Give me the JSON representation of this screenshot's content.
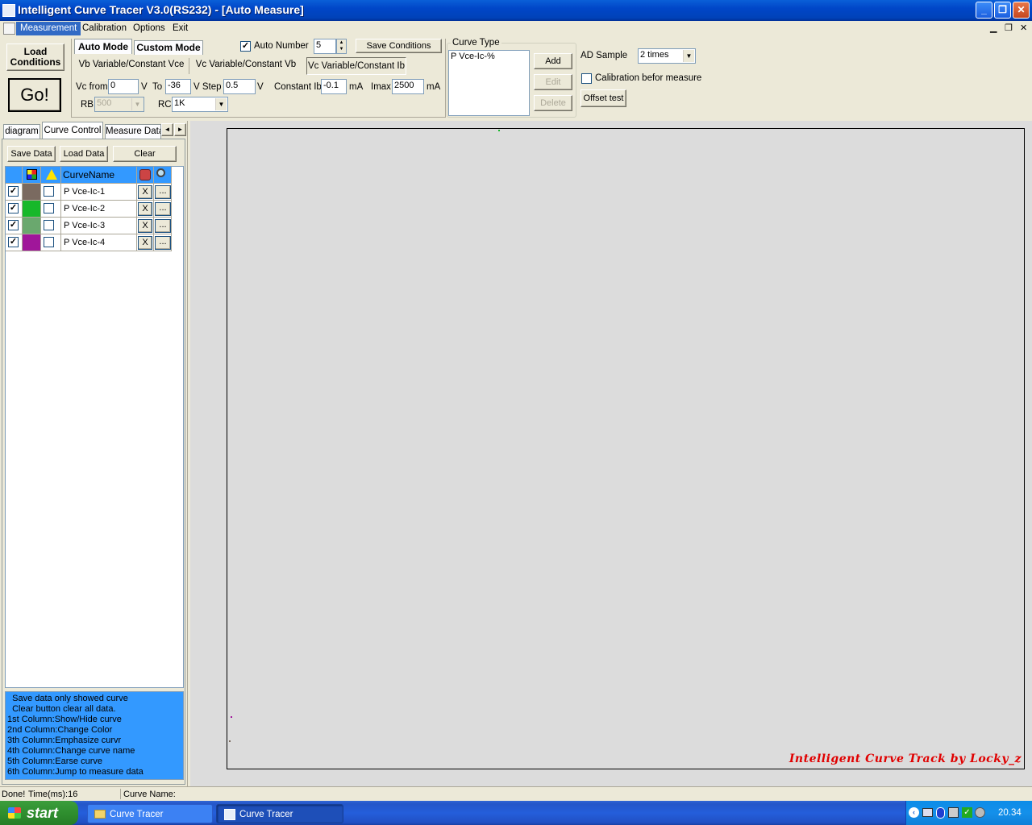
{
  "window": {
    "title": "Intelligent Curve Tracer V3.0(RS232) - [Auto Measure]",
    "controls": {
      "minimize": "_",
      "maximize": "❐",
      "close": "✕"
    }
  },
  "menu": [
    "Measurement",
    "Calibration",
    "Options",
    "Exit"
  ],
  "toolbar": {
    "load_conditions": "Load Conditions",
    "go": "Go!",
    "mode_tabs": [
      "Auto Mode",
      "Custom Mode"
    ],
    "auto_number_label": "Auto Number",
    "auto_number_checked": "✓",
    "auto_number_value": "5",
    "save_conditions": "Save Conditions",
    "sub_tabs": [
      "Vb Variable/Constant Vce",
      "Vc Variable/Constant Vb",
      "Vc Variable/Constant Ib"
    ],
    "vc_from_label": "Vc from",
    "vc_from_value": "0",
    "v_unit": "V",
    "to_label": "To",
    "to_value": "-36",
    "step_label": "V Step",
    "step_value": "0.5",
    "step_unit": "V",
    "constant_ib_label": "Constant Ib",
    "constant_ib_value": "-0.1",
    "ma_unit": "mA",
    "imax_label": "Imax",
    "imax_value": "2500",
    "imax_unit": "mA",
    "rb_label": "RB",
    "rb_value": "500",
    "rc_label": "RC",
    "rc_value": "1K"
  },
  "curve_type": {
    "title": "Curve Type",
    "items": [
      "P Vce-Ic-%"
    ],
    "add": "Add",
    "edit": "Edit",
    "delete": "Delete"
  },
  "ad": {
    "sample_label": "AD Sample",
    "sample_value": "2 times",
    "calibration_label": "Calibration befor measure",
    "offset_test": "Offset test"
  },
  "left_tabs": [
    "diagram",
    "Curve Control",
    "Measure Data"
  ],
  "left_tab_scroll": {
    "left": "◄",
    "right": "►"
  },
  "left_buttons": {
    "save": "Save Data",
    "load": "Load Data",
    "clear": "Clear"
  },
  "grid": {
    "header_name": "CurveName",
    "rows": [
      {
        "shown": "✓",
        "color": "#7a6a60",
        "name": "P Vce-Ic-1",
        "erase": "X",
        "jump": "..."
      },
      {
        "shown": "✓",
        "color": "#17b82a",
        "name": "P Vce-Ic-2",
        "erase": "X",
        "jump": "..."
      },
      {
        "shown": "✓",
        "color": "#6aa86e",
        "name": "P Vce-Ic-3",
        "erase": "X",
        "jump": "..."
      },
      {
        "shown": "✓",
        "color": "#a0169a",
        "name": "P Vce-Ic-4",
        "erase": "X",
        "jump": "..."
      }
    ]
  },
  "help_lines": [
    "  Save data only showed curve",
    "  Clear button clear all data.",
    "1st Column:Show/Hide curve",
    "2nd Column:Change Color",
    "3th Column:Emphasize curvr",
    "4th Column:Change curve name",
    "5th Column:Earse curve",
    "6th Column:Jump to measure data"
  ],
  "plot": {
    "watermark": "Intelligent Curve Track by Locky_z"
  },
  "status": {
    "done": "Done!",
    "time": "Time(ms):16",
    "curve_name": "Curve Name:"
  },
  "taskbar": {
    "start": "start",
    "tasks": [
      "Curve Tracer",
      "Curve Tracer"
    ],
    "clock": "20.34"
  },
  "colors": {
    "accent": "#316ac5",
    "help_bg": "#3399ff",
    "plot_bg": "#dcdcdc"
  }
}
